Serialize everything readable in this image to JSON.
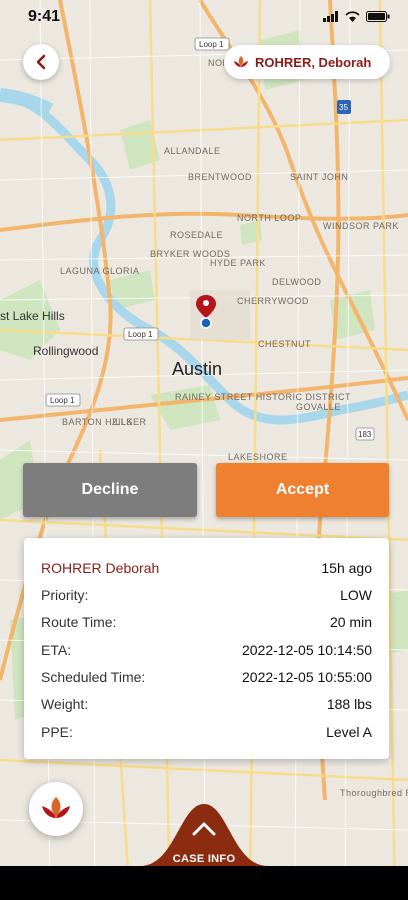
{
  "status_bar": {
    "time": "9:41"
  },
  "map": {
    "labels": {
      "austin": "Austin",
      "rollingwood": "Rollingwood",
      "west_lake_hills": "st Lake Hills",
      "north_campus": "NORTH CAM",
      "allandale": "ALLANDALE",
      "brentwood": "BRENTWOOD",
      "saint_john": "SAINT JOHN",
      "north_loop": "NORTH LOOP",
      "windsor_park": "WINDSOR PARK",
      "rosedale": "ROSEDALE",
      "bryker_woods": "BRYKER WOODS",
      "hyde_park": "HYDE PARK",
      "delwood": "DELWOOD",
      "cherrywood": "CHERRYWOOD",
      "laguna_gloria": "LAGUNA GLORIA",
      "chestnut": "CHESTNUT",
      "rainey_street": "RAINEY STREET HISTORIC DISTRICT",
      "govalle": "GOVALLE",
      "barton_hills": "BARTON HILLS",
      "zilker": "ZILKER",
      "lakeshore": "LAKESHORE",
      "thoroughbred": "Thoroughbred Ranchettes",
      "loop1_a": "Loop 1",
      "loop1_b": "Loop 1",
      "loop1_c": "Loop 1",
      "shield_35": "35",
      "shield_183": "183"
    }
  },
  "header": {
    "patient_chip_name": "ROHRER, Deborah"
  },
  "actions": {
    "decline_label": "Decline",
    "accept_label": "Accept"
  },
  "case": {
    "patient_name": "ROHRER Deborah",
    "age": "15h ago",
    "rows": [
      {
        "label": "Priority:",
        "value": "LOW"
      },
      {
        "label": "Route Time:",
        "value": "20 min"
      },
      {
        "label": "ETA:",
        "value": "2022-12-05 10:14:50"
      },
      {
        "label": "Scheduled Time:",
        "value": "2022-12-05 10:55:00"
      },
      {
        "label": "Weight:",
        "value": "188 lbs"
      },
      {
        "label": "PPE:",
        "value": "Level A"
      }
    ]
  },
  "footer": {
    "case_info_label": "CASE INFO"
  },
  "colors": {
    "brand_red": "#8b1c17",
    "accept_orange": "#ee8030",
    "decline_gray": "#7d7d7d"
  },
  "icons": [
    "back-chevron-icon",
    "leaf-logo-icon",
    "map-pin-icon",
    "current-location-icon",
    "chevron-up-icon",
    "signal-icon",
    "wifi-icon",
    "battery-icon"
  ]
}
